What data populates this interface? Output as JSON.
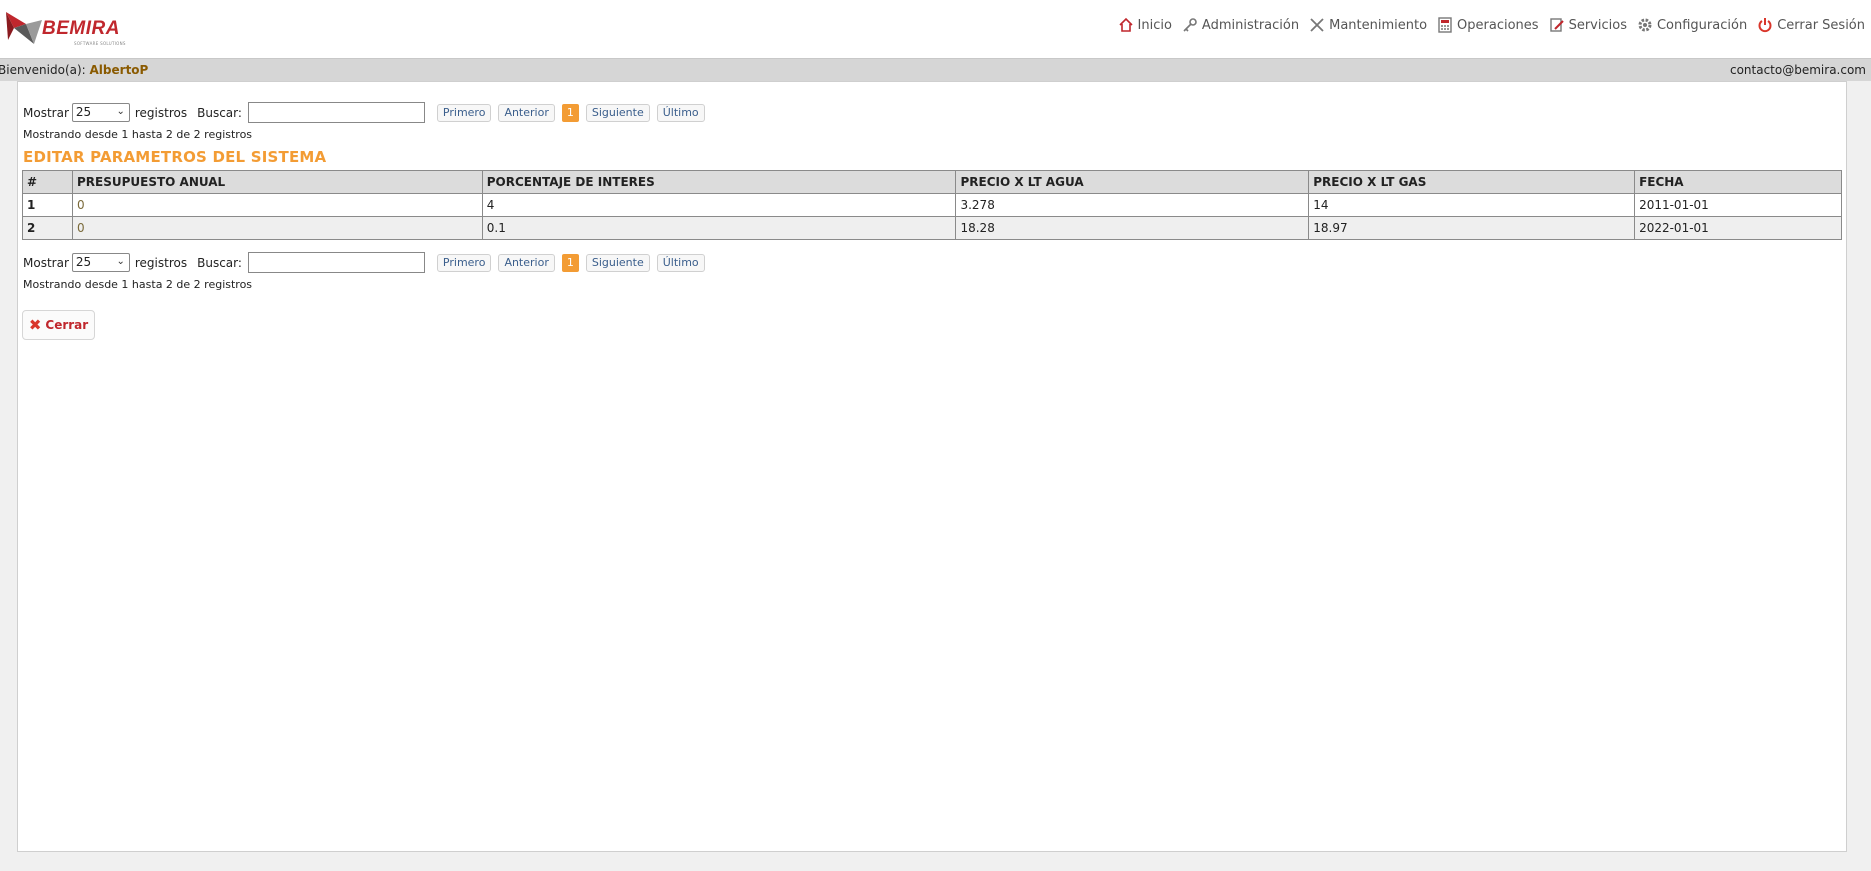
{
  "brand": {
    "name": "BEMIRA",
    "tagline": "SOFTWARE SOLUTIONS"
  },
  "nav": {
    "items": [
      {
        "label": "Inicio",
        "icon": "home-icon"
      },
      {
        "label": "Administración",
        "icon": "key-icon"
      },
      {
        "label": "Mantenimiento",
        "icon": "tools-icon"
      },
      {
        "label": "Operaciones",
        "icon": "calculator-icon"
      },
      {
        "label": "Servicios",
        "icon": "edit-icon"
      },
      {
        "label": "Configuración",
        "icon": "gear-icon"
      },
      {
        "label": "Cerrar Sesión",
        "icon": "power-icon"
      }
    ]
  },
  "welcome": {
    "prefix": "Bienvenido(a): ",
    "user": "AlbertoP",
    "email": "contacto@bemira.com"
  },
  "controls": {
    "show_label": "Mostrar",
    "page_size": "25",
    "records_label": "registros",
    "search_label": "Buscar:",
    "search_value": "",
    "first": "Primero",
    "prev": "Anterior",
    "current_page": "1",
    "next": "Siguiente",
    "last": "Último",
    "info": "Mostrando desde 1 hasta 2 de 2 registros"
  },
  "page_title": "EDITAR PARAMETROS DEL SISTEMA",
  "table": {
    "headers": [
      "#",
      "PRESUPUESTO ANUAL",
      "PORCENTAJE DE INTERES",
      "PRECIO X LT AGUA",
      "PRECIO X LT GAS",
      "FECHA"
    ],
    "rows": [
      [
        "1",
        "0",
        "4",
        "3.278",
        "14",
        "2011-01-01"
      ],
      [
        "2",
        "0",
        "0.1",
        "18.28",
        "18.97",
        "2022-01-01"
      ]
    ]
  },
  "close_button": "Cerrar",
  "colors": {
    "accent": "#f39c34",
    "brand_red": "#c0272d"
  }
}
